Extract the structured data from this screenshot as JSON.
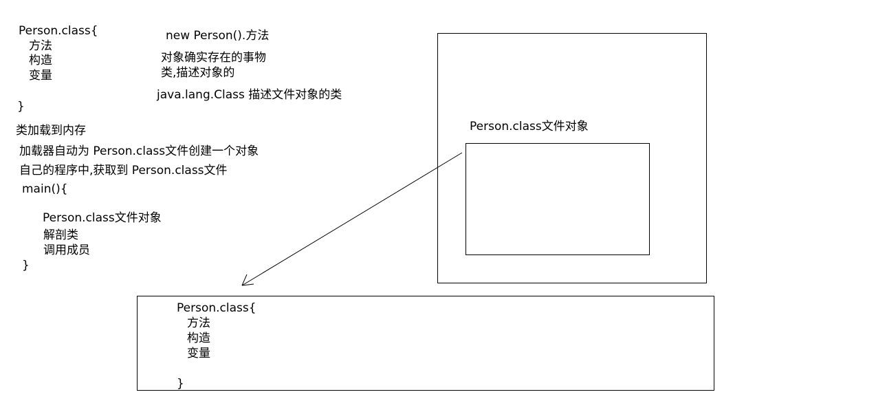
{
  "left_notes": {
    "class_open": "Person.class{",
    "members": [
      "方法",
      "构造",
      "变量"
    ],
    "class_close": "}",
    "load_title": "类加载到内存",
    "auto_create": "加载器自动为 Person.class文件创建一个对象",
    "get_in_program": "自己的程序中,获取到 Person.class文件",
    "main_open": "main(){",
    "file_object": "Person.class文件对象",
    "actions": [
      "解剖类",
      "调用成员"
    ],
    "main_close": "}"
  },
  "top_notes": {
    "new_person": "new Person().方法",
    "object_def": "对象确实存在的事物",
    "class_def": "类,描述对象的",
    "class_class": "java.lang.Class 描述文件对象的类"
  },
  "memory_box": {
    "label": "Person.class文件对象"
  },
  "bottom_box": {
    "class_open": "Person.class{",
    "members": [
      "方法",
      "构造",
      "变量"
    ],
    "class_close": "}"
  }
}
